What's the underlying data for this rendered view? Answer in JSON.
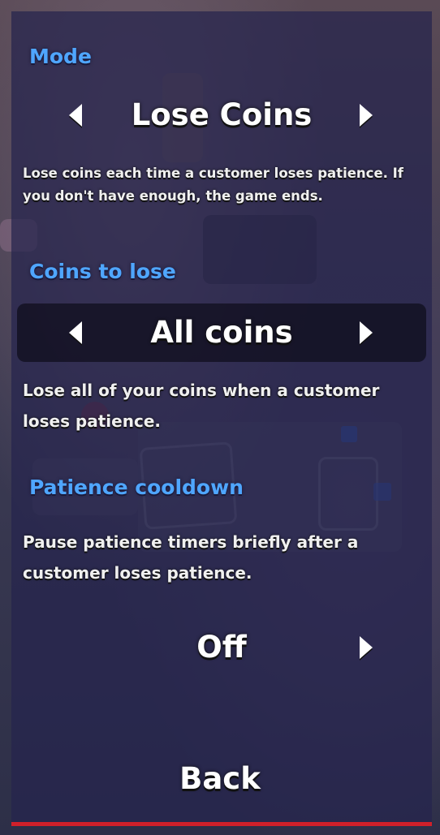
{
  "mode": {
    "heading": "Mode",
    "value": "Lose Coins",
    "description": "Lose coins each time a customer loses patience. If you don't have enough, the game ends."
  },
  "coins_to_lose": {
    "heading": "Coins to lose",
    "value": "All coins",
    "description": "Lose all of your coins when a customer loses patience."
  },
  "patience_cooldown": {
    "heading": "Patience cooldown",
    "description": "Pause patience timers briefly after a customer loses patience.",
    "value": "Off"
  },
  "back_label": "Back",
  "colors": {
    "heading": "#4fa6ff",
    "accent_bar": "#d0202a",
    "panel": "#26244e"
  }
}
